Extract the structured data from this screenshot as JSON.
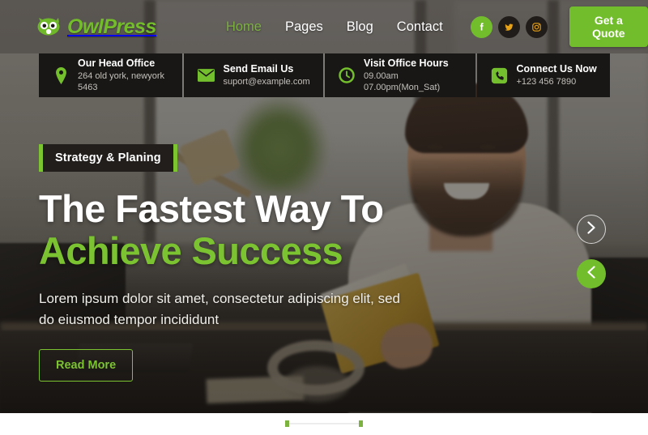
{
  "brand": {
    "name": "OwlPress",
    "logo_icon": "owl-icon",
    "accent_color": "#72bd2c",
    "accent_light": "#7cc331",
    "dark_panel": "#191715"
  },
  "header": {
    "nav": [
      {
        "label": "Home",
        "active": true
      },
      {
        "label": "Pages",
        "active": false
      },
      {
        "label": "Blog",
        "active": false
      },
      {
        "label": "Contact",
        "active": false
      }
    ],
    "socials": [
      {
        "name": "facebook-icon",
        "glyph": "f"
      },
      {
        "name": "twitter-icon",
        "glyph": "t"
      },
      {
        "name": "instagram-icon",
        "glyph": "i"
      }
    ],
    "cta_label": "Get a Quote"
  },
  "infobar": [
    {
      "icon": "location-pin-icon",
      "title": "Our Head Office",
      "sub": "264 old york, newyork 5463"
    },
    {
      "icon": "envelope-icon",
      "title": "Send Email Us",
      "sub": "suport@example.com"
    },
    {
      "icon": "clock-icon",
      "title": "Visit Office Hours",
      "sub": "09.00am 07.00pm(Mon_Sat)"
    },
    {
      "icon": "phone-icon",
      "title": "Connect Us Now",
      "sub": "+123 456 7890"
    }
  ],
  "hero": {
    "badge": "Strategy & Planing",
    "heading_line1": "The Fastest Way To",
    "heading_line2": "Achieve Success",
    "lead": "Lorem ipsum dolor sit amet, consectetur adipiscing elit, sed do eiusmod tempor incididunt",
    "button_label": "Read More",
    "carousel": {
      "next_icon": "chevron-right-icon",
      "prev_icon": "chevron-left-icon"
    }
  }
}
